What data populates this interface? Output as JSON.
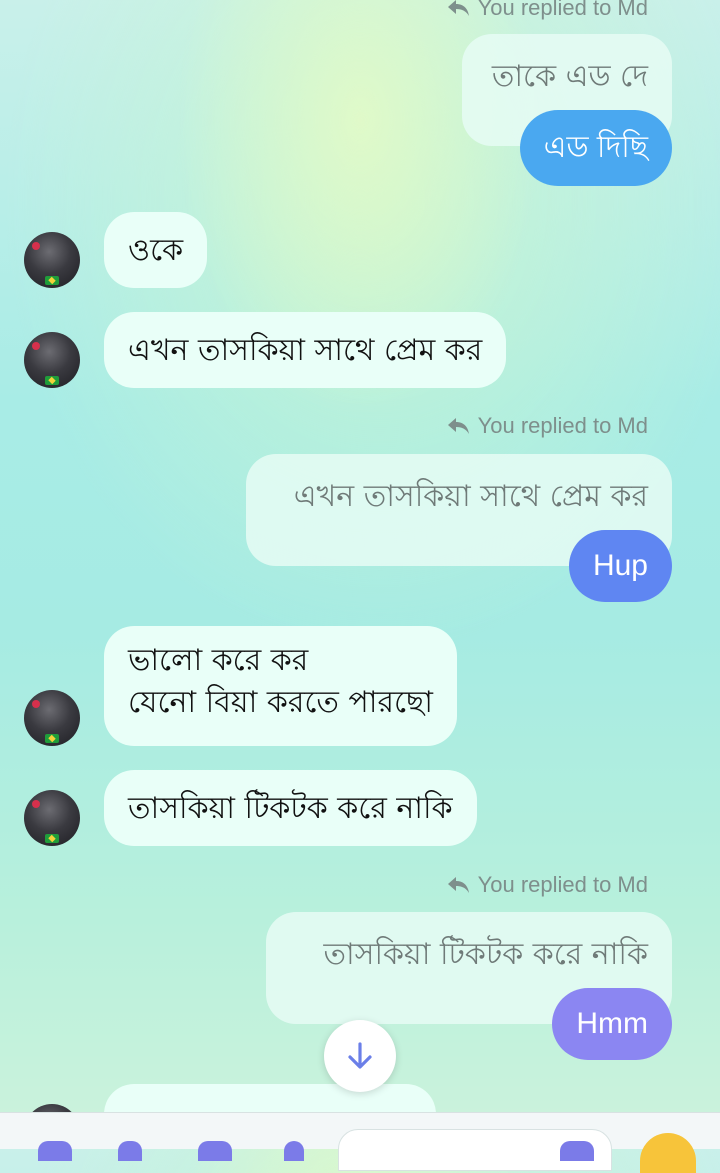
{
  "messages": {
    "reply1": {
      "note": "You replied to Md",
      "quoted": "তাকে এড দে",
      "reply": "এড দিছি"
    },
    "in1": "ওকে",
    "in2": "এখন তাসকিয়া সাথে প্রেম কর",
    "reply2": {
      "note": "You replied to Md",
      "quoted": "এখন তাসকিয়া সাথে প্রেম কর",
      "reply": "Hup"
    },
    "in3_line1": "ভালো করে কর",
    "in3_line2": "যেনো বিয়া করতে পারছো",
    "in4": "তাসকিয়া টিকটক করে নাকি",
    "reply3": {
      "note": "You replied to Md",
      "quoted": "তাসকিয়া টিকটক করে নাকি",
      "reply": "Hmm"
    }
  },
  "colors": {
    "reply1_bubble": "#4aa8f0",
    "reply2_bubble": "#5f86f2",
    "reply3_bubble": "#8b86f2",
    "incoming_bubble": "#e9fff8"
  },
  "icons": {
    "reply": "reply-arrow-icon",
    "scroll": "arrow-down-icon"
  }
}
